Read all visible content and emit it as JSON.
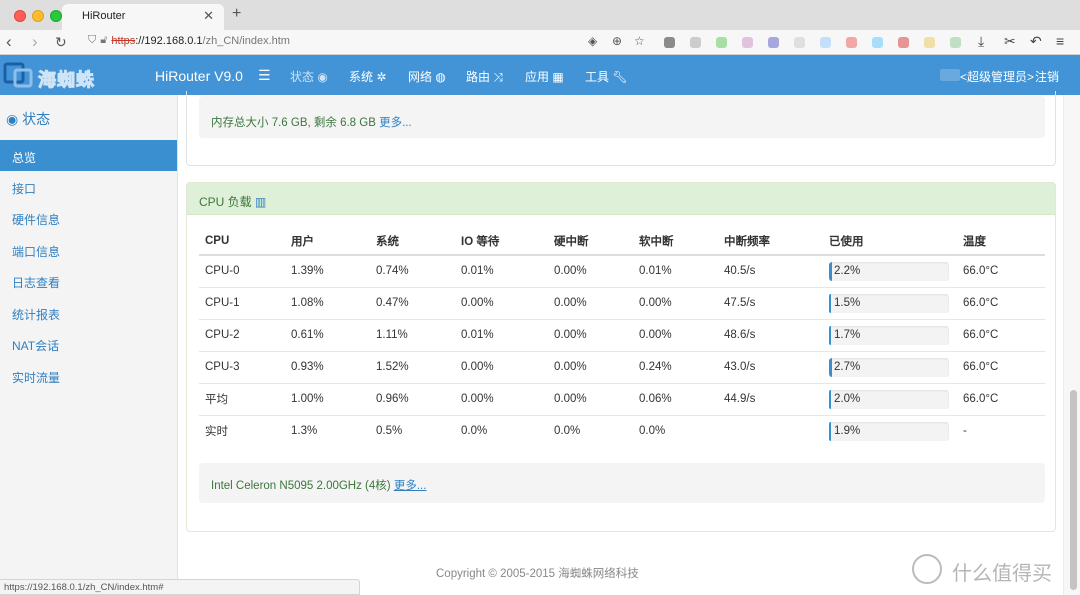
{
  "browser": {
    "tab_title": "HiRouter",
    "tab_close": "✕",
    "new_tab": "+",
    "url_https": "https",
    "url_host": "://192.168.0.1",
    "url_path": "/zh_CN/index.htm",
    "status_url": "https://192.168.0.1/zh_CN/index.htm#"
  },
  "header": {
    "logo_text": "海蜘蛛",
    "brand": "HiRouter V9.0",
    "nav": [
      "状态",
      "系统",
      "网络",
      "路由",
      "应用",
      "工具"
    ],
    "user": "<超级管理员>",
    "logout": "注销"
  },
  "sidebar": {
    "title": "状态",
    "items": [
      "总览",
      "接口",
      "硬件信息",
      "端口信息",
      "日志查看",
      "统计报表",
      "NAT会话",
      "实时流量"
    ],
    "active": "总览"
  },
  "memory": {
    "text": "内存总大小 7.6 GB, 剩余 6.8 GB",
    "more": "更多..."
  },
  "cpu_panel": {
    "title": "CPU 负载",
    "headers": [
      "CPU",
      "用户",
      "系统",
      "IO 等待",
      "硬中断",
      "软中断",
      "中断频率",
      "已使用",
      "温度"
    ],
    "rows": [
      {
        "cpu": "CPU-0",
        "user": "1.39%",
        "sys": "0.74%",
        "io": "0.01%",
        "hirq": "0.00%",
        "sirq": "0.01%",
        "freq": "40.5/s",
        "used": "2.2%",
        "used_pct": 2.2,
        "temp": "66.0°C"
      },
      {
        "cpu": "CPU-1",
        "user": "1.08%",
        "sys": "0.47%",
        "io": "0.00%",
        "hirq": "0.00%",
        "sirq": "0.00%",
        "freq": "47.5/s",
        "used": "1.5%",
        "used_pct": 1.5,
        "temp": "66.0°C"
      },
      {
        "cpu": "CPU-2",
        "user": "0.61%",
        "sys": "1.11%",
        "io": "0.01%",
        "hirq": "0.00%",
        "sirq": "0.00%",
        "freq": "48.6/s",
        "used": "1.7%",
        "used_pct": 1.7,
        "temp": "66.0°C"
      },
      {
        "cpu": "CPU-3",
        "user": "0.93%",
        "sys": "1.52%",
        "io": "0.00%",
        "hirq": "0.00%",
        "sirq": "0.24%",
        "freq": "43.0/s",
        "used": "2.7%",
        "used_pct": 2.7,
        "temp": "66.0°C"
      },
      {
        "cpu": "平均",
        "user": "1.00%",
        "sys": "0.96%",
        "io": "0.00%",
        "hirq": "0.00%",
        "sirq": "0.06%",
        "freq": "44.9/s",
        "used": "2.0%",
        "used_pct": 2.0,
        "temp": "66.0°C"
      },
      {
        "cpu": "实时",
        "user": "1.3%",
        "sys": "0.5%",
        "io": "0.0%",
        "hirq": "0.0%",
        "sirq": "0.0%",
        "freq": "",
        "used": "1.9%",
        "used_pct": 1.9,
        "temp": "-"
      }
    ],
    "model": "Intel Celeron N5095 2.00GHz (4核)",
    "model_more": "更多..."
  },
  "footer": {
    "copyright": "Copyright © 2005-2015 海蜘蛛网络科技"
  },
  "watermark": "什么值得买",
  "colors": {
    "header_bg": "#4394d6",
    "sidebar_active": "#3a8fd1",
    "panel_heading": "#dff0d8",
    "link": "#2f7fc1",
    "green_text": "#3c763d"
  }
}
